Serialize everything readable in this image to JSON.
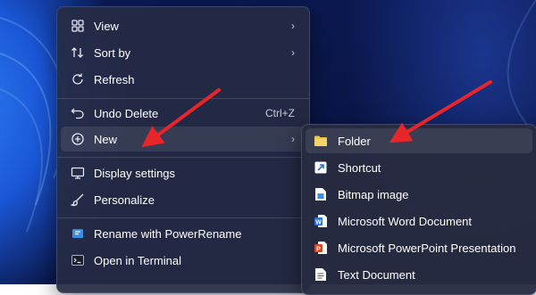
{
  "context_menu": {
    "items": [
      {
        "label": "View",
        "icon": "grid-view-icon",
        "has_submenu": true
      },
      {
        "label": "Sort by",
        "icon": "sort-arrows-icon",
        "has_submenu": true
      },
      {
        "label": "Refresh",
        "icon": "refresh-icon"
      },
      {
        "label": "Undo Delete",
        "icon": "undo-icon",
        "shortcut": "Ctrl+Z"
      },
      {
        "label": "New",
        "icon": "plus-circle-icon",
        "has_submenu": true,
        "highlighted": true
      },
      {
        "label": "Display settings",
        "icon": "monitor-icon"
      },
      {
        "label": "Personalize",
        "icon": "brush-icon"
      },
      {
        "label": "Rename with PowerRename",
        "icon": "powerrename-icon"
      },
      {
        "label": "Open in Terminal",
        "icon": "terminal-icon"
      }
    ]
  },
  "new_submenu": {
    "items": [
      {
        "label": "Folder",
        "icon": "folder-icon",
        "highlighted": true
      },
      {
        "label": "Shortcut",
        "icon": "shortcut-icon"
      },
      {
        "label": "Bitmap image",
        "icon": "bitmap-icon"
      },
      {
        "label": "Microsoft Word Document",
        "icon": "word-icon"
      },
      {
        "label": "Microsoft PowerPoint Presentation",
        "icon": "powerpoint-icon"
      },
      {
        "label": "Text Document",
        "icon": "text-document-icon"
      }
    ]
  },
  "colors": {
    "annotation_arrow": "#e8262a",
    "folder": "#f3c54b",
    "word": "#2b6fd6",
    "powerpoint": "#d24726"
  }
}
